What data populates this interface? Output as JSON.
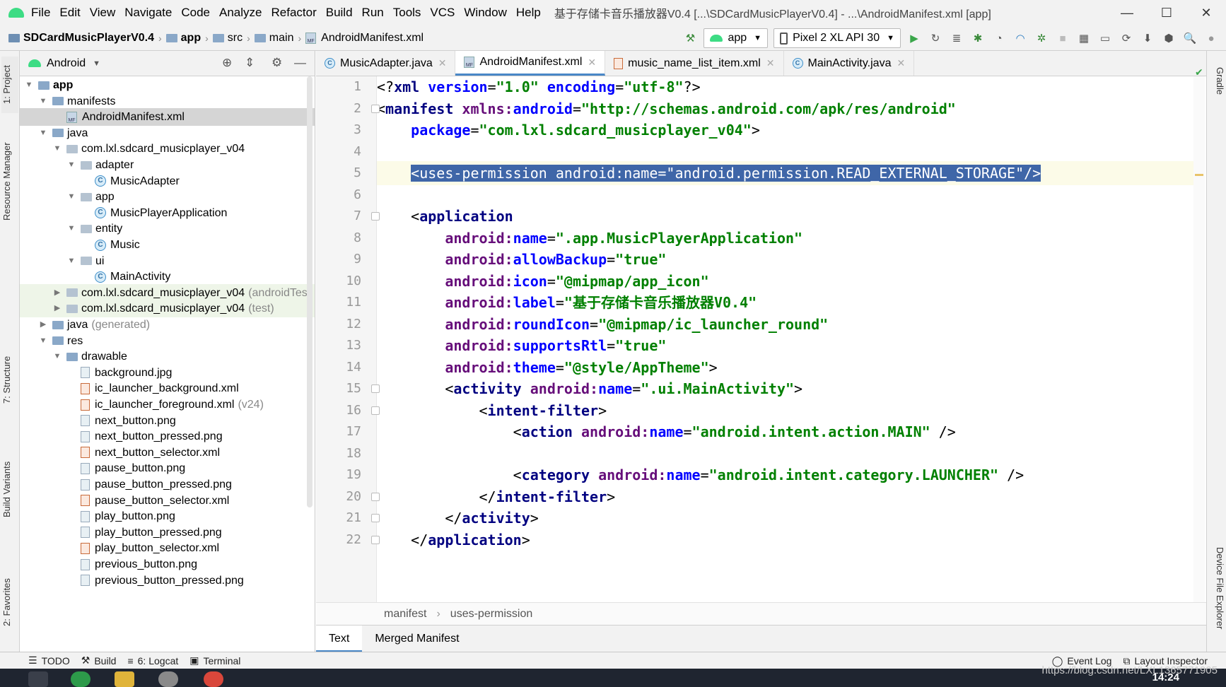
{
  "window": {
    "menu": [
      "File",
      "Edit",
      "View",
      "Navigate",
      "Code",
      "Analyze",
      "Refactor",
      "Build",
      "Run",
      "Tools",
      "VCS",
      "Window",
      "Help"
    ],
    "title": "基于存储卡音乐播放器V0.4 [...\\SDCardMusicPlayerV0.4] - ...\\AndroidManifest.xml [app]",
    "controls": {
      "minimize": "—",
      "maximize": "☐",
      "close": "✕"
    }
  },
  "breadcrumb": [
    "SDCardMusicPlayerV0.4",
    "app",
    "src",
    "main",
    "AndroidManifest.xml"
  ],
  "toolbar": {
    "run_config": "app",
    "device": "Pixel 2 XL API 30"
  },
  "left_strip": [
    "1: Project",
    "Resource Manager",
    "7: Structure",
    "Build Variants",
    "2: Favorites"
  ],
  "right_strip": [
    "Gradle",
    "Device File Explorer"
  ],
  "project_panel": {
    "view_selector": "Android",
    "tree": [
      {
        "label": "app",
        "depth": 0,
        "kind": "folder",
        "expanded": true,
        "bold": true
      },
      {
        "label": "manifests",
        "depth": 1,
        "kind": "folder",
        "expanded": true
      },
      {
        "label": "AndroidManifest.xml",
        "depth": 2,
        "kind": "manifest",
        "selected": true
      },
      {
        "label": "java",
        "depth": 1,
        "kind": "folder",
        "expanded": true
      },
      {
        "label": "com.lxl.sdcard_musicplayer_v04",
        "depth": 2,
        "kind": "package",
        "expanded": true
      },
      {
        "label": "adapter",
        "depth": 3,
        "kind": "package",
        "expanded": true
      },
      {
        "label": "MusicAdapter",
        "depth": 4,
        "kind": "class"
      },
      {
        "label": "app",
        "depth": 3,
        "kind": "package",
        "expanded": true
      },
      {
        "label": "MusicPlayerApplication",
        "depth": 4,
        "kind": "class"
      },
      {
        "label": "entity",
        "depth": 3,
        "kind": "package",
        "expanded": true
      },
      {
        "label": "Music",
        "depth": 4,
        "kind": "class"
      },
      {
        "label": "ui",
        "depth": 3,
        "kind": "package",
        "expanded": true
      },
      {
        "label": "MainActivity",
        "depth": 4,
        "kind": "class"
      },
      {
        "label": "com.lxl.sdcard_musicplayer_v04",
        "suffix": "(androidTes",
        "depth": 2,
        "kind": "package",
        "expanded": false,
        "test": true
      },
      {
        "label": "com.lxl.sdcard_musicplayer_v04",
        "suffix": "(test)",
        "depth": 2,
        "kind": "package",
        "expanded": false,
        "test": true
      },
      {
        "label": "java",
        "suffix": "(generated)",
        "depth": 1,
        "kind": "folder",
        "expanded": false
      },
      {
        "label": "res",
        "depth": 1,
        "kind": "folder",
        "expanded": true
      },
      {
        "label": "drawable",
        "depth": 2,
        "kind": "folder",
        "expanded": true
      },
      {
        "label": "background.jpg",
        "depth": 3,
        "kind": "img"
      },
      {
        "label": "ic_launcher_background.xml",
        "depth": 3,
        "kind": "xml"
      },
      {
        "label": "ic_launcher_foreground.xml",
        "suffix": "(v24)",
        "depth": 3,
        "kind": "xml"
      },
      {
        "label": "next_button.png",
        "depth": 3,
        "kind": "img"
      },
      {
        "label": "next_button_pressed.png",
        "depth": 3,
        "kind": "img"
      },
      {
        "label": "next_button_selector.xml",
        "depth": 3,
        "kind": "xml"
      },
      {
        "label": "pause_button.png",
        "depth": 3,
        "kind": "img"
      },
      {
        "label": "pause_button_pressed.png",
        "depth": 3,
        "kind": "img"
      },
      {
        "label": "pause_button_selector.xml",
        "depth": 3,
        "kind": "xml"
      },
      {
        "label": "play_button.png",
        "depth": 3,
        "kind": "img"
      },
      {
        "label": "play_button_pressed.png",
        "depth": 3,
        "kind": "img"
      },
      {
        "label": "play_button_selector.xml",
        "depth": 3,
        "kind": "xml"
      },
      {
        "label": "previous_button.png",
        "depth": 3,
        "kind": "img"
      },
      {
        "label": "previous_button_pressed.png",
        "depth": 3,
        "kind": "img"
      }
    ]
  },
  "editor_tabs": [
    {
      "label": "MusicAdapter.java",
      "icon": "java-class-icon",
      "active": false
    },
    {
      "label": "AndroidManifest.xml",
      "icon": "manifest-icon",
      "active": true
    },
    {
      "label": "music_name_list_item.xml",
      "icon": "xml-file-icon",
      "active": false
    },
    {
      "label": "MainActivity.java",
      "icon": "java-class-icon",
      "active": false
    }
  ],
  "code": {
    "current_line": 5,
    "lines": [
      [
        [
          "pn",
          "<?"
        ],
        [
          "tag",
          "xml "
        ],
        [
          "attr",
          "version"
        ],
        [
          "pn",
          "="
        ],
        [
          "val",
          "\"1.0\" "
        ],
        [
          "attr",
          "encoding"
        ],
        [
          "pn",
          "="
        ],
        [
          "val",
          "\"utf-8\""
        ],
        [
          "pn",
          "?>"
        ]
      ],
      [
        [
          "pn",
          "<"
        ],
        [
          "tag",
          "manifest "
        ],
        [
          "ns",
          "xmlns:"
        ],
        [
          "attr",
          "android"
        ],
        [
          "pn",
          "="
        ],
        [
          "val",
          "\"http://schemas.android.com/apk/res/android\""
        ]
      ],
      [
        [
          "pn",
          "    "
        ],
        [
          "attr",
          "package"
        ],
        [
          "pn",
          "="
        ],
        [
          "val",
          "\"com.lxl.sdcard_musicplayer_v04\""
        ],
        [
          "pn",
          ">"
        ]
      ],
      [
        [
          "pn",
          ""
        ]
      ],
      [
        [
          "pn",
          "    "
        ],
        [
          "hl",
          "<uses-permission android:name=\"android.permission.READ_EXTERNAL_STORAGE\"/>"
        ]
      ],
      [
        [
          "pn",
          ""
        ]
      ],
      [
        [
          "pn",
          "    <"
        ],
        [
          "tag",
          "application"
        ]
      ],
      [
        [
          "pn",
          "        "
        ],
        [
          "ns",
          "android:"
        ],
        [
          "attr",
          "name"
        ],
        [
          "pn",
          "="
        ],
        [
          "val",
          "\".app.MusicPlayerApplication\""
        ]
      ],
      [
        [
          "pn",
          "        "
        ],
        [
          "ns",
          "android:"
        ],
        [
          "attr",
          "allowBackup"
        ],
        [
          "pn",
          "="
        ],
        [
          "val",
          "\"true\""
        ]
      ],
      [
        [
          "pn",
          "        "
        ],
        [
          "ns",
          "android:"
        ],
        [
          "attr",
          "icon"
        ],
        [
          "pn",
          "="
        ],
        [
          "val",
          "\"@mipmap/app_icon\""
        ]
      ],
      [
        [
          "pn",
          "        "
        ],
        [
          "ns",
          "android:"
        ],
        [
          "attr",
          "label"
        ],
        [
          "pn",
          "="
        ],
        [
          "val",
          "\"基于存储卡音乐播放器V0.4\""
        ]
      ],
      [
        [
          "pn",
          "        "
        ],
        [
          "ns",
          "android:"
        ],
        [
          "attr",
          "roundIcon"
        ],
        [
          "pn",
          "="
        ],
        [
          "val",
          "\"@mipmap/ic_launcher_round\""
        ]
      ],
      [
        [
          "pn",
          "        "
        ],
        [
          "ns",
          "android:"
        ],
        [
          "attr",
          "supportsRtl"
        ],
        [
          "pn",
          "="
        ],
        [
          "val",
          "\"true\""
        ]
      ],
      [
        [
          "pn",
          "        "
        ],
        [
          "ns",
          "android:"
        ],
        [
          "attr",
          "theme"
        ],
        [
          "pn",
          "="
        ],
        [
          "val",
          "\"@style/AppTheme\""
        ],
        [
          "pn",
          ">"
        ]
      ],
      [
        [
          "pn",
          "        <"
        ],
        [
          "tag",
          "activity "
        ],
        [
          "ns",
          "android:"
        ],
        [
          "attr",
          "name"
        ],
        [
          "pn",
          "="
        ],
        [
          "val",
          "\".ui.MainActivity\""
        ],
        [
          "pn",
          ">"
        ]
      ],
      [
        [
          "pn",
          "            <"
        ],
        [
          "tag",
          "intent-filter"
        ],
        [
          "pn",
          ">"
        ]
      ],
      [
        [
          "pn",
          "                <"
        ],
        [
          "tag",
          "action "
        ],
        [
          "ns",
          "android:"
        ],
        [
          "attr",
          "name"
        ],
        [
          "pn",
          "="
        ],
        [
          "val",
          "\"android.intent.action.MAIN\" "
        ],
        [
          "pn",
          "/>"
        ]
      ],
      [
        [
          "pn",
          ""
        ]
      ],
      [
        [
          "pn",
          "                <"
        ],
        [
          "tag",
          "category "
        ],
        [
          "ns",
          "android:"
        ],
        [
          "attr",
          "name"
        ],
        [
          "pn",
          "="
        ],
        [
          "val",
          "\"android.intent.category.LAUNCHER\" "
        ],
        [
          "pn",
          "/>"
        ]
      ],
      [
        [
          "pn",
          "            </"
        ],
        [
          "tag",
          "intent-filter"
        ],
        [
          "pn",
          ">"
        ]
      ],
      [
        [
          "pn",
          "        </"
        ],
        [
          "tag",
          "activity"
        ],
        [
          "pn",
          ">"
        ]
      ],
      [
        [
          "pn",
          "    </"
        ],
        [
          "tag",
          "application"
        ],
        [
          "pn",
          ">"
        ]
      ]
    ]
  },
  "editor_breadcrumb": [
    "manifest",
    "uses-permission"
  ],
  "editor_subtabs": [
    {
      "label": "Text",
      "active": true
    },
    {
      "label": "Merged Manifest",
      "active": false
    }
  ],
  "bottom_tools": [
    {
      "label": "TODO",
      "icon": "list-icon"
    },
    {
      "label": "Build",
      "icon": "hammer-icon"
    },
    {
      "label": "6: Logcat",
      "icon": "logcat-icon"
    },
    {
      "label": "Terminal",
      "icon": "terminal-icon"
    }
  ],
  "bottom_right": [
    {
      "label": "Event Log",
      "icon": "event-log-icon"
    },
    {
      "label": "Layout Inspector",
      "icon": "layout-inspector-icon"
    }
  ],
  "watermark": "https://blog.csdn.net/LXL1365771905",
  "clock": "14:24"
}
